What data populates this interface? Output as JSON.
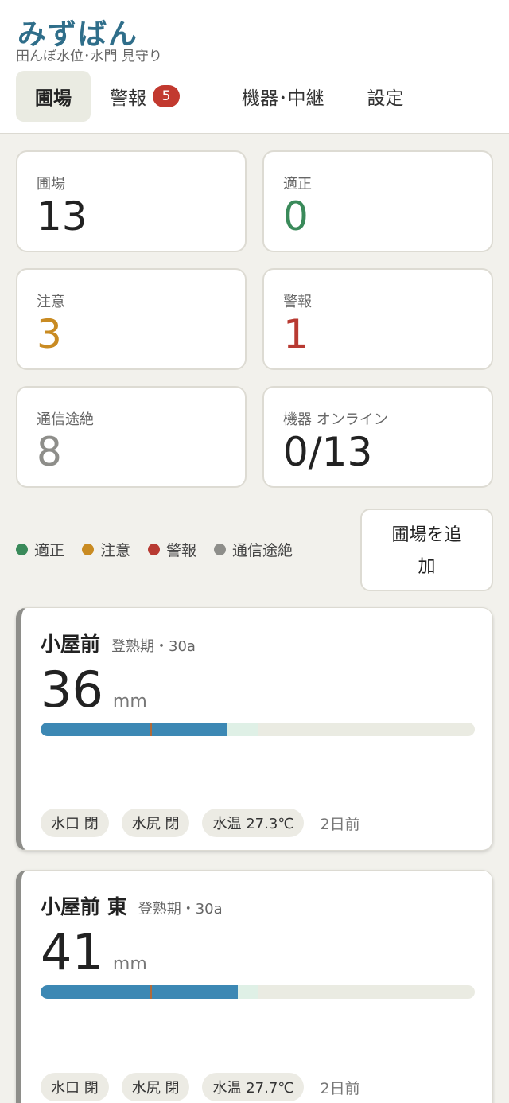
{
  "header": {
    "app_title": "みずばん",
    "app_subtitle": "田んぼ水位･水門 見守り"
  },
  "tabs": [
    {
      "label": "圃場"
    },
    {
      "label": "警報",
      "badge": "5"
    },
    {
      "label": "機器･中継"
    },
    {
      "label": "設定"
    }
  ],
  "stats": [
    {
      "label": "圃場",
      "value": "13"
    },
    {
      "label": "適正",
      "value": "0"
    },
    {
      "label": "注意",
      "value": "3"
    },
    {
      "label": "警報",
      "value": "1"
    },
    {
      "label": "通信途絶",
      "value": "8"
    },
    {
      "label": "機器 オンライン",
      "value": "0/13"
    }
  ],
  "legend": [
    {
      "label": "適正",
      "color": "#3a8a5a"
    },
    {
      "label": "注意",
      "color": "#c98b22"
    },
    {
      "label": "警報",
      "color": "#b83a32"
    },
    {
      "label": "通信途絶",
      "color": "#8e8e8a"
    }
  ],
  "add_button": {
    "line1": "圃場を追",
    "line2": "加"
  },
  "fields": [
    {
      "name": "小屋前",
      "meta": "登熟期・30a",
      "level": "36",
      "unit": "mm",
      "fill_fraction": 0.43,
      "band_fraction": [
        0.43,
        0.5
      ],
      "marker_fraction": 0.25,
      "chips": [
        "水口 閉",
        "水尻 閉",
        "水温 27.3℃"
      ],
      "updated": "2日前"
    },
    {
      "name": "小屋前 東",
      "meta": "登熟期・30a",
      "level": "41",
      "unit": "mm",
      "fill_fraction": 0.455,
      "band_fraction": [
        0.455,
        0.5
      ],
      "marker_fraction": 0.25,
      "chips": [
        "水口 閉",
        "水尻 閉",
        "水温 27.7℃"
      ],
      "updated": "2日前"
    }
  ]
}
